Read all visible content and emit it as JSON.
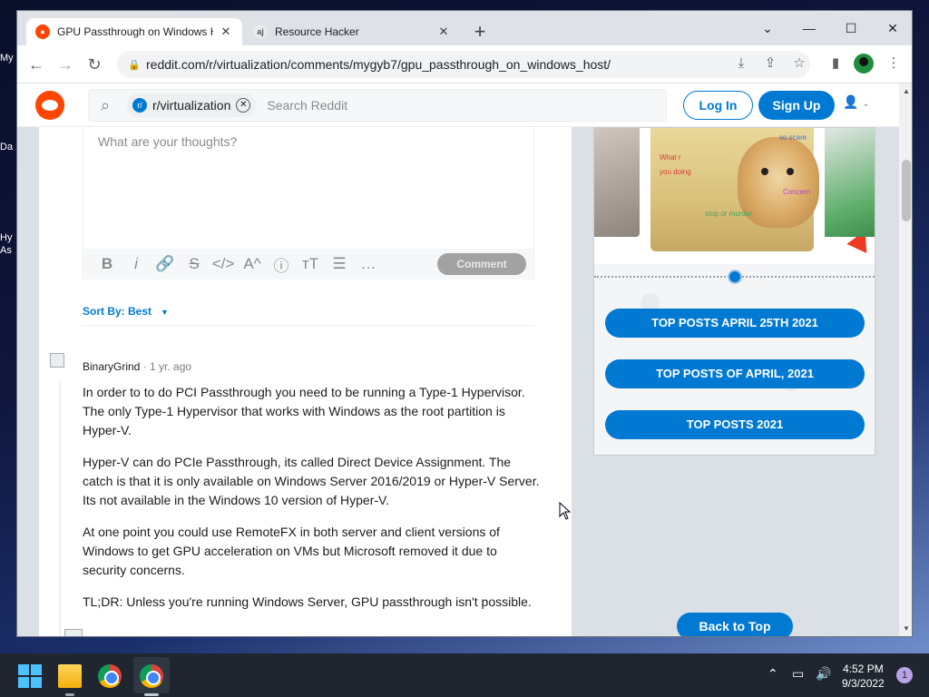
{
  "desktop": {
    "icon_labels": [
      "My",
      "Da",
      "Hy",
      "As"
    ]
  },
  "browser": {
    "tabs": [
      {
        "title": "GPU Passthrough on Windows H",
        "active": true
      },
      {
        "title": "Resource Hacker",
        "active": false
      }
    ],
    "url": "reddit.com/r/virtualization/comments/mygyb7/gpu_passthrough_on_windows_host/"
  },
  "reddit": {
    "search": {
      "subreddit_chip": "r/virtualization",
      "placeholder": "Search Reddit"
    },
    "login_label": "Log In",
    "signup_label": "Sign Up",
    "comment_box": {
      "placeholder": "What are your thoughts?",
      "comment_button": "Comment"
    },
    "sort_by": "Sort By: Best",
    "comment": {
      "author": "BinaryGrind",
      "time": "· 1 yr. ago",
      "paragraphs": [
        "In order to to do PCI Passthrough you need to be running a Type-1 Hypervisor. The only Type-1 Hypervisor that works with Windows as the root partition is Hyper-V.",
        "Hyper-V can do PCIe Passthrough, its called Direct Device Assignment. The catch is that it is only available on Windows Server 2016/2019 or Hyper-V Server. Its not available in the Windows 10 version of Hyper-V.",
        "At one point you could use RemoteFX in both server and client versions of Windows to get GPU acceleration on VMs but Microsoft removed it due to security concerns.",
        "TL;DR: Unless you're running Windows Server, GPU passthrough isn't possible."
      ]
    },
    "sidebar": {
      "image_texts": [
        "so scare",
        "What r",
        "you doing",
        "Concern",
        "stop or murder"
      ],
      "buttons": [
        "TOP POSTS APRIL 25TH 2021",
        "TOP POSTS OF APRIL, 2021",
        "TOP POSTS 2021"
      ]
    },
    "back_to_top": "Back to Top"
  },
  "taskbar": {
    "time": "4:52 PM",
    "date": "9/3/2022",
    "notification_count": "1"
  },
  "colors": {
    "reddit_blue": "#0079d3",
    "reddit_orange": "#ff4500",
    "page_bg": "#dae0e6"
  }
}
